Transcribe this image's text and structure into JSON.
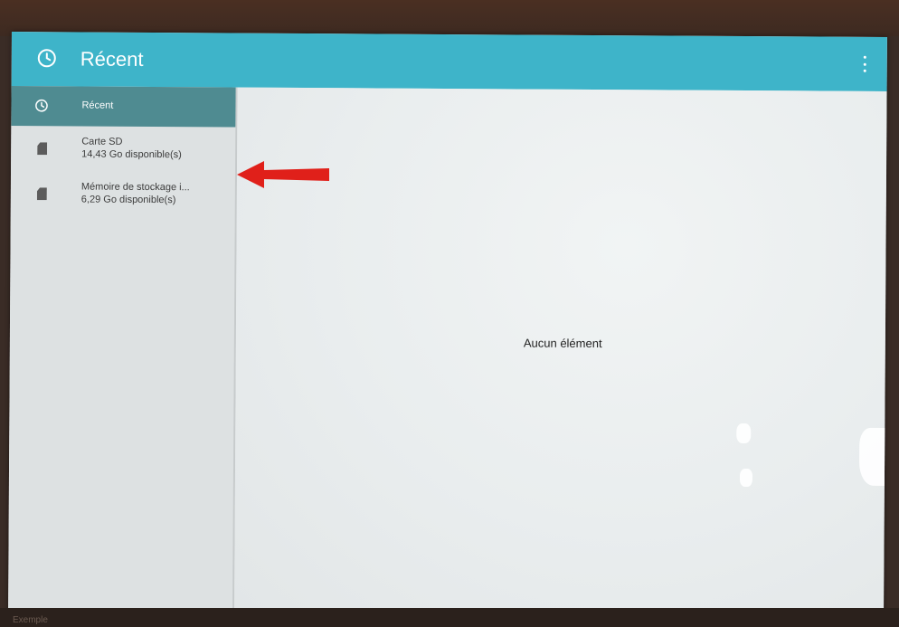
{
  "app": {
    "title": "Récent"
  },
  "sidebar": {
    "items": [
      {
        "label": "Récent",
        "icon": "clock-icon",
        "selected": true
      },
      {
        "label": "Carte SD",
        "detail": "14,43 Go disponible(s)",
        "icon": "sd-card-icon"
      },
      {
        "label": "Mémoire de stockage i...",
        "detail": "6,29 Go disponible(s)",
        "icon": "sd-card-icon"
      }
    ]
  },
  "main": {
    "empty_text": "Aucun élément"
  },
  "colors": {
    "appbar": "#3eb4c9",
    "selected_item": "#4f8b91",
    "arrow": "#e0201a"
  },
  "footer": {
    "hint": "Exemple"
  }
}
